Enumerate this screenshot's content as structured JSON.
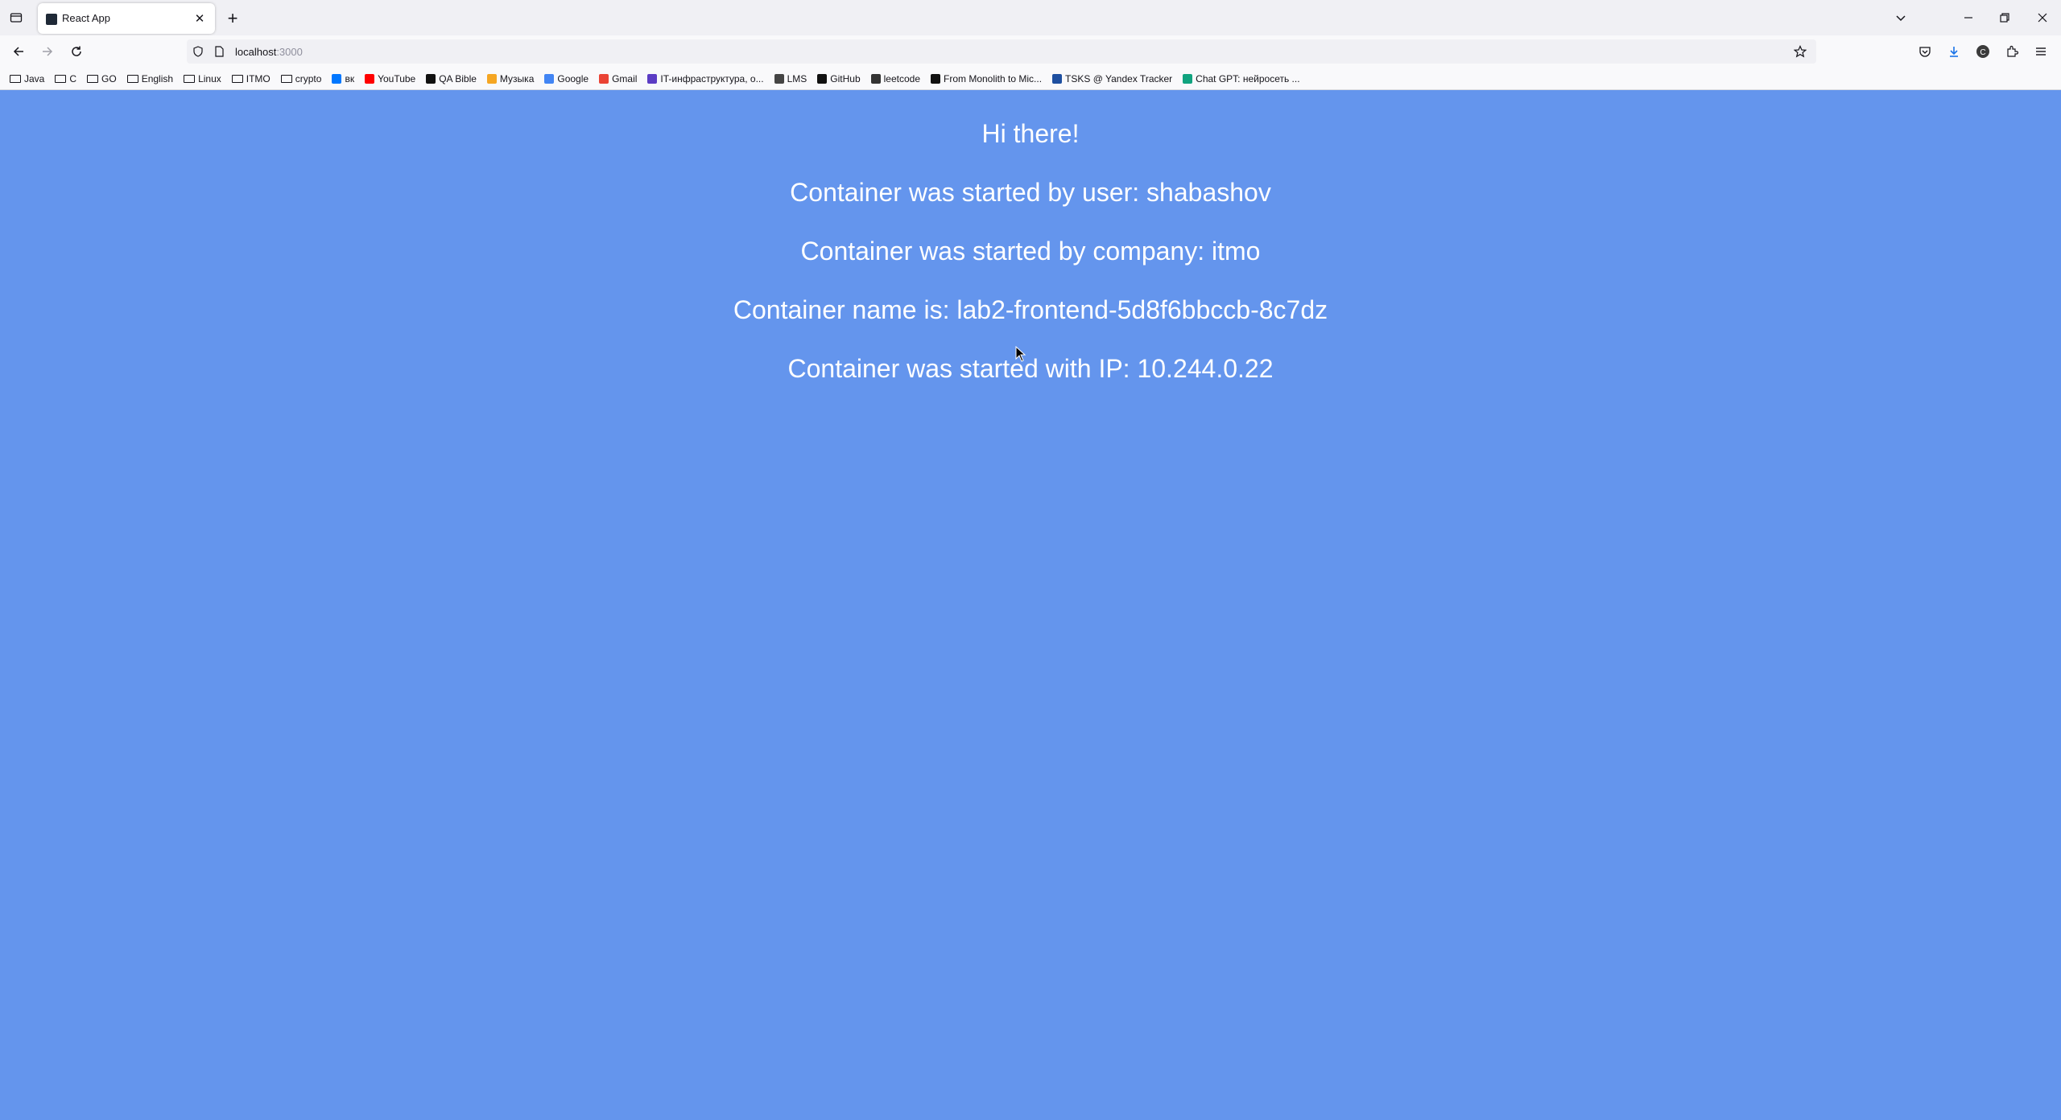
{
  "browser": {
    "tab": {
      "title": "React App"
    },
    "url": {
      "host": "localhost",
      "port": ":3000"
    },
    "bookmarks": [
      {
        "label": "Java",
        "icon": "folder-icon"
      },
      {
        "label": "C",
        "icon": "folder-icon"
      },
      {
        "label": "GO",
        "icon": "folder-icon"
      },
      {
        "label": "English",
        "icon": "folder-icon"
      },
      {
        "label": "Linux",
        "icon": "folder-icon"
      },
      {
        "label": "ITMO",
        "icon": "folder-icon"
      },
      {
        "label": "crypto",
        "icon": "folder-icon"
      },
      {
        "label": "вк",
        "icon": "vk-icon",
        "color": "#0077ff"
      },
      {
        "label": "YouTube",
        "icon": "youtube-icon",
        "color": "#ff0000"
      },
      {
        "label": "QA Bible",
        "icon": "qa-bible-icon",
        "color": "#111111"
      },
      {
        "label": "Музыка",
        "icon": "music-icon",
        "color": "#f5a623"
      },
      {
        "label": "Google",
        "icon": "google-icon",
        "color": "#4285f4"
      },
      {
        "label": "Gmail",
        "icon": "gmail-icon",
        "color": "#ea4335"
      },
      {
        "label": "IT-инфраструктура, о...",
        "icon": "it-infra-icon",
        "color": "#5b3cc4"
      },
      {
        "label": "LMS",
        "icon": "globe-icon",
        "color": "#444444"
      },
      {
        "label": "GitHub",
        "icon": "github-icon",
        "color": "#111111"
      },
      {
        "label": "leetcode",
        "icon": "leetcode-icon",
        "color": "#333333"
      },
      {
        "label": "From Monolith to Mic...",
        "icon": "monolith-icon",
        "color": "#111111"
      },
      {
        "label": "TSKS @ Yandex Tracker",
        "icon": "tracker-icon",
        "color": "#1e4fa0"
      },
      {
        "label": "Chat GPT: нейросеть ...",
        "icon": "chatgpt-icon",
        "color": "#10a37f"
      }
    ]
  },
  "page": {
    "greeting": "Hi there!",
    "user_line": "Container was started by user: shabashov",
    "company_line": "Container was started by company: itmo",
    "name_line": "Container name is: lab2-frontend-5d8f6bbccb-8c7dz",
    "ip_line": "Container was started with IP: 10.244.0.22"
  },
  "colors": {
    "page_background": "#6495ed",
    "text": "#ffffff"
  }
}
